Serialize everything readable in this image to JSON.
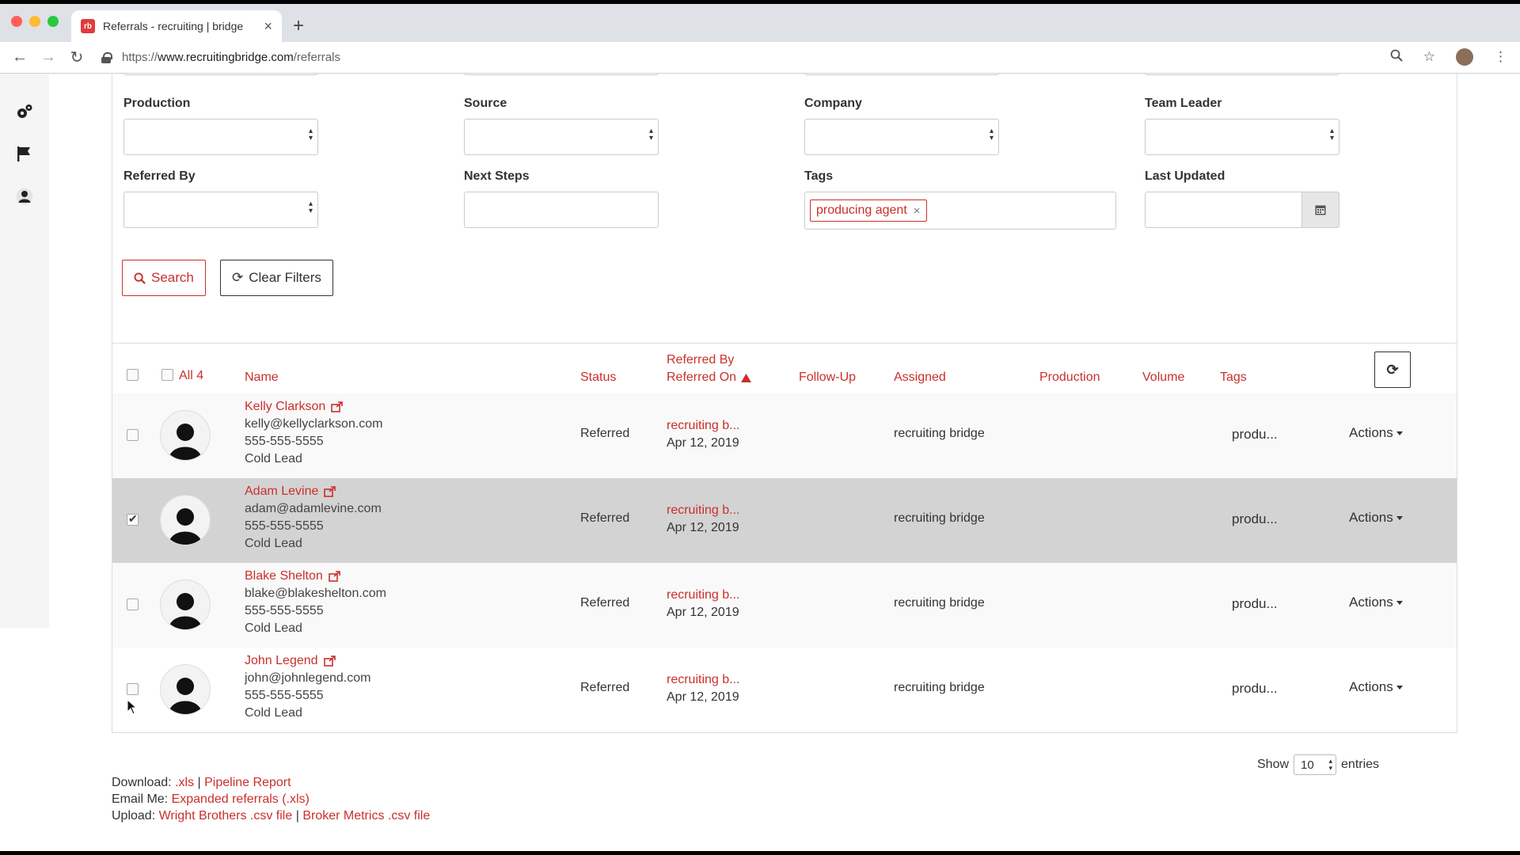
{
  "browser": {
    "tab_title": "Referrals - recruiting | bridge",
    "favicon_text": "rb",
    "url_prefix": "https://",
    "url_domain": "www.recruitingbridge.com",
    "url_path": "/referrals"
  },
  "filters": {
    "production_label": "Production",
    "source_label": "Source",
    "company_label": "Company",
    "team_leader_label": "Team Leader",
    "referred_by_label": "Referred By",
    "next_steps_label": "Next Steps",
    "tags_label": "Tags",
    "last_updated_label": "Last Updated",
    "tag_chip": "producing agent",
    "tag_remove": "×",
    "search_button": "Search",
    "clear_button": "Clear Filters"
  },
  "table": {
    "all_label": "All 4",
    "headers": {
      "name": "Name",
      "status": "Status",
      "referred_by": "Referred By",
      "referred_on": "Referred On",
      "follow_up": "Follow-Up",
      "assigned": "Assigned",
      "production": "Production",
      "volume": "Volume",
      "tags": "Tags"
    },
    "rows": [
      {
        "name": "Kelly Clarkson",
        "email": "kelly@kellyclarkson.com",
        "phone": "555-555-5555",
        "lead": "Cold Lead",
        "status": "Referred",
        "referred_by": "recruiting b...",
        "referred_on": "Apr 12, 2019",
        "assigned": "recruiting bridge",
        "tags": "produ...",
        "actions": "Actions",
        "checked": false
      },
      {
        "name": "Adam Levine",
        "email": "adam@adamlevine.com",
        "phone": "555-555-5555",
        "lead": "Cold Lead",
        "status": "Referred",
        "referred_by": "recruiting b...",
        "referred_on": "Apr 12, 2019",
        "assigned": "recruiting bridge",
        "tags": "produ...",
        "actions": "Actions",
        "checked": true
      },
      {
        "name": "Blake Shelton",
        "email": "blake@blakeshelton.com",
        "phone": "555-555-5555",
        "lead": "Cold Lead",
        "status": "Referred",
        "referred_by": "recruiting b...",
        "referred_on": "Apr 12, 2019",
        "assigned": "recruiting bridge",
        "tags": "produ...",
        "actions": "Actions",
        "checked": false
      },
      {
        "name": "John Legend",
        "email": "john@johnlegend.com",
        "phone": "555-555-5555",
        "lead": "Cold Lead",
        "status": "Referred",
        "referred_by": "recruiting b...",
        "referred_on": "Apr 12, 2019",
        "assigned": "recruiting bridge",
        "tags": "produ...",
        "actions": "Actions",
        "checked": false
      }
    ]
  },
  "pagination": {
    "show_label": "Show",
    "entries_value": "10",
    "entries_label": "entries"
  },
  "footer": {
    "download_label": "Download:",
    "xls_link": ".xls",
    "separator": "|",
    "pipeline_link": "Pipeline Report",
    "email_label": "Email Me:",
    "expanded_link": "Expanded referrals (.xls)",
    "upload_label": "Upload:",
    "wright_link": "Wright Brothers .csv file",
    "broker_link": "Broker Metrics .csv file"
  },
  "icons": {
    "sidebar": [
      "gears-icon",
      "flag-icon",
      "user-icon"
    ]
  },
  "colors": {
    "accent": "#c9302c",
    "selected_row": "#d3d3d3"
  }
}
